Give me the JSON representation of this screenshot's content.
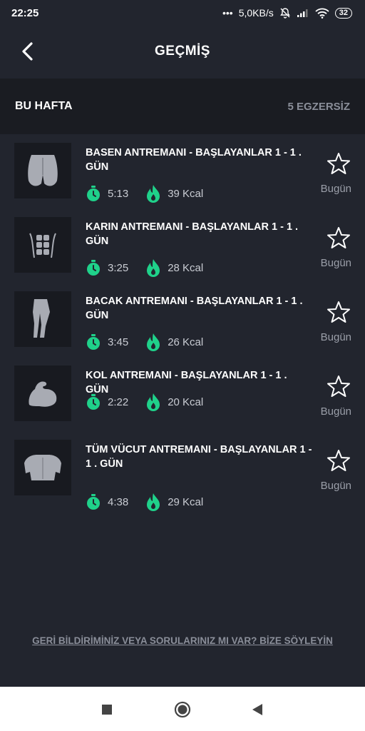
{
  "status_bar": {
    "time": "22:25",
    "dots": "•••",
    "network_speed": "5,0KB/s",
    "battery": "32"
  },
  "header": {
    "title": "GEÇMİŞ",
    "back_icon": "chevron-left-icon"
  },
  "week": {
    "title": "BU HAFTA",
    "count": "5 EGZERSİZ"
  },
  "accent_color": "#1fd18a",
  "workouts": [
    {
      "title": "BASEN ANTREMANI - BAŞLAYANLAR 1 - 1 . GÜN",
      "duration": "5:13",
      "calories": "39 Kcal",
      "day": "Bugün",
      "icon": "glutes-icon"
    },
    {
      "title": "KARIN ANTREMANI - BAŞLAYANLAR 1 - 1 . GÜN",
      "duration": "3:25",
      "calories": "28 Kcal",
      "day": "Bugün",
      "icon": "abs-icon"
    },
    {
      "title": "BACAK ANTREMANI - BAŞLAYANLAR 1 - 1 . GÜN",
      "duration": "3:45",
      "calories": "26 Kcal",
      "day": "Bugün",
      "icon": "legs-icon"
    },
    {
      "title": "KOL ANTREMANI - BAŞLAYANLAR 1 - 1 . GÜN",
      "duration": "2:22",
      "calories": "20 Kcal",
      "day": "Bugün",
      "icon": "arm-icon"
    },
    {
      "title": "TÜM VÜCUT ANTREMANI - BAŞLAYANLAR 1 - 1 . GÜN",
      "duration": "4:38",
      "calories": "29 Kcal",
      "day": "Bugün",
      "icon": "full-body-icon"
    }
  ],
  "feedback": {
    "text": "GERİ BİLDİRİMİNİZ VEYA SORULARINIZ MI VAR? BİZE SÖYLEYİN"
  }
}
